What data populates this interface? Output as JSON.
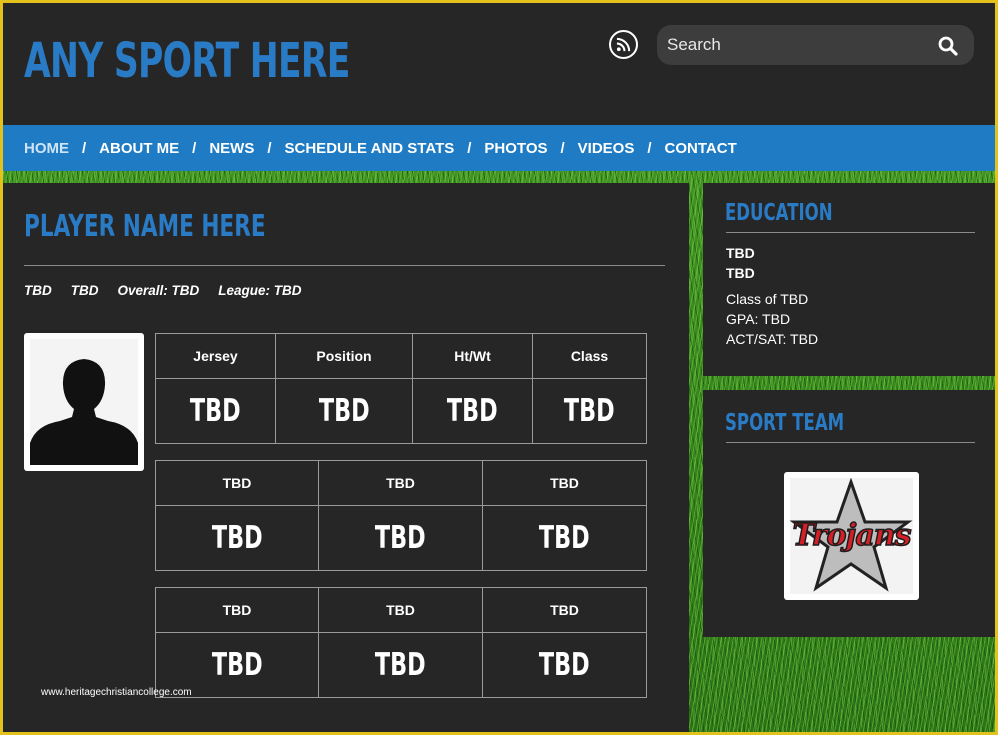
{
  "header": {
    "site_title": "ANY SPORT HERE",
    "search_placeholder": "Search",
    "rss_icon": "rss-icon",
    "search_icon": "search-icon"
  },
  "nav": {
    "items": [
      "HOME",
      "ABOUT ME",
      "NEWS",
      "SCHEDULE AND STATS",
      "PHOTOS",
      "VIDEOS",
      "CONTACT"
    ],
    "separator": "/",
    "active": "HOME"
  },
  "main": {
    "player_name": "PLAYER NAME HERE",
    "stats_line": [
      "TBD",
      "TBD",
      "Overall: TBD",
      "League: TBD"
    ],
    "table1": {
      "headers": [
        "Jersey",
        "Position",
        "Ht/Wt",
        "Class"
      ],
      "values": [
        "TBD",
        "TBD",
        "TBD",
        "TBD"
      ]
    },
    "table2": {
      "headers": [
        "TBD",
        "TBD",
        "TBD"
      ],
      "values": [
        "TBD",
        "TBD",
        "TBD"
      ]
    },
    "table3": {
      "headers": [
        "TBD",
        "TBD",
        "TBD"
      ],
      "values": [
        "TBD",
        "TBD",
        "TBD"
      ]
    },
    "watermark": "www.heritagechristiancollege.com"
  },
  "sidebar": {
    "education": {
      "title": "EDUCATION",
      "bold_lines": [
        "TBD",
        "TBD"
      ],
      "lines": [
        "Class of TBD",
        "GPA: TBD",
        "ACT/SAT: TBD"
      ]
    },
    "sport_team": {
      "title": "SPORT TEAM",
      "logo_text": "Trojans"
    }
  },
  "colors": {
    "accent": "#1f7cc4",
    "title_blue": "#2a7bc6",
    "panel": "#262626",
    "frame": "#e3c21d",
    "grass": "#3f9424",
    "logo_red": "#d41f26"
  }
}
